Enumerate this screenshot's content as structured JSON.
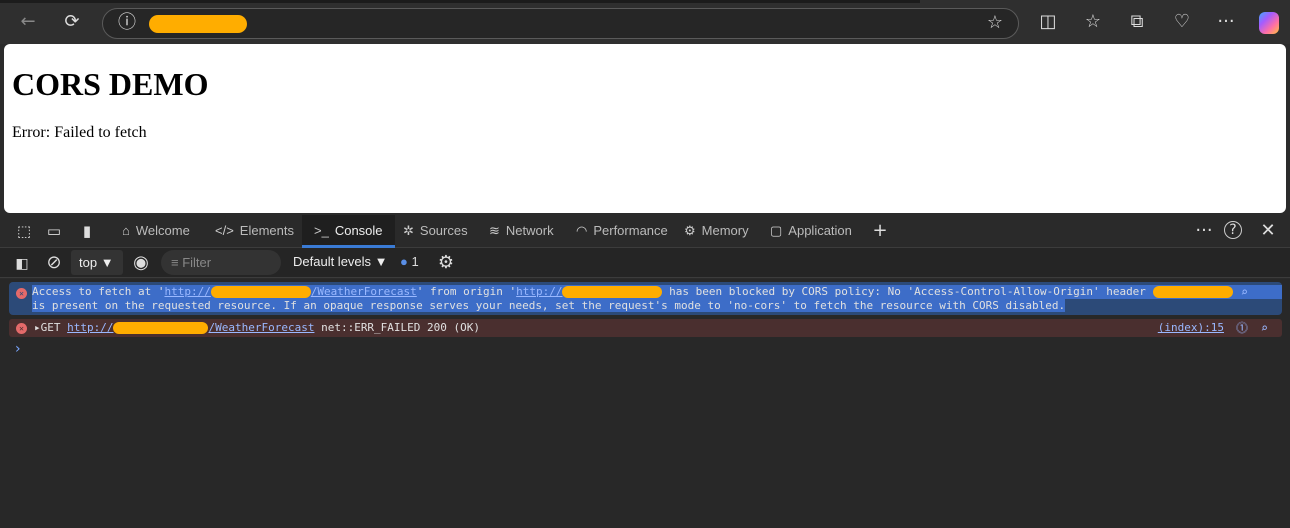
{
  "browser": {
    "back": "←",
    "reload": "⟳",
    "info": "ⓘ",
    "star": "☆",
    "split": "◫",
    "favorites": "☆",
    "collections": "⧉",
    "health": "♡",
    "more": "···"
  },
  "page": {
    "title": "CORS DEMO",
    "error": "Error: Failed to fetch"
  },
  "devtools": {
    "tabs": [
      {
        "label": "Welcome",
        "icon": "⌂"
      },
      {
        "label": "Elements",
        "icon": "</>"
      },
      {
        "label": "Console",
        "icon": ">_"
      },
      {
        "label": "Sources",
        "icon": "✲"
      },
      {
        "label": "Network",
        "icon": "≋"
      },
      {
        "label": "Performance",
        "icon": "◠"
      },
      {
        "label": "Memory",
        "icon": "⚙"
      },
      {
        "label": "Application",
        "icon": "▢"
      }
    ],
    "add": "+",
    "more": "···",
    "help": "?",
    "close": "✕"
  },
  "toolbar": {
    "context": "top",
    "filter_placeholder": "Filter",
    "levels": "Default levels",
    "issues_count": "1"
  },
  "messages": [
    {
      "type": "error",
      "p1": "Access to fetch at '",
      "url1": "http://",
      "url1b": "/WeatherForecast",
      "p2": "' from origin '",
      "url2": "http://",
      "p3": " has been blocked by CORS policy: No 'Access-Control-Allow-Origin' header",
      "line2": "is present on the requested resource. If an opaque response serves your needs, set the request's mode to 'no-cors' to fetch the resource with CORS disabled."
    },
    {
      "type": "error",
      "method": "GET",
      "url": "http://",
      "urlb": "/WeatherForecast",
      "status": "net::ERR_FAILED 200 (OK)",
      "source": "(index):15"
    }
  ],
  "prompt": "›"
}
